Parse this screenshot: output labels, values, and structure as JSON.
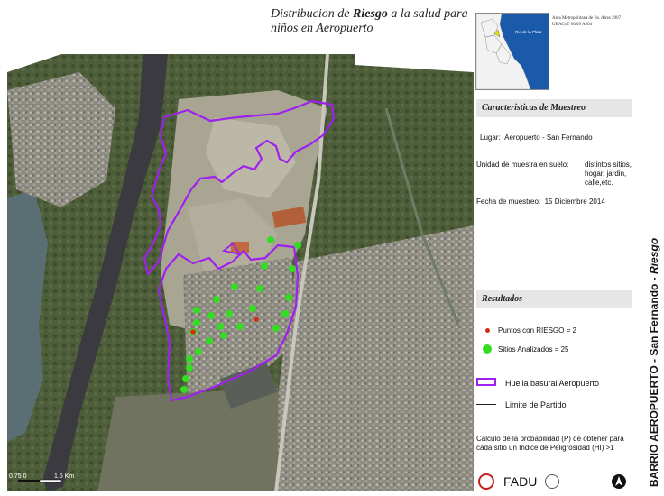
{
  "title": {
    "line1_pre": "Distribucion de ",
    "line1_bold": "Riesgo",
    "line1_post": " a la salud para",
    "line2": "niños en  Aeropuerto"
  },
  "inset": {
    "river_label": "Rio de la Plata",
    "note_line1": "Area Metropolitana de Bs. Aires 2007",
    "note_line2": "UBACyT 06/09   A804"
  },
  "muestreo": {
    "heading": "Caracteristicas de Muestreo",
    "lugar_label": "Lugar:",
    "lugar_value": "Aeropuerto - San Fernando",
    "unidad_label": "Unidad de muestra en suelo:",
    "unidad_value_1": "distintos sitios,",
    "unidad_value_2": "hogar, jardin,",
    "unidad_value_3": "calle,etc.",
    "fecha_label": "Fecha de muestreo:",
    "fecha_value": "15 Diciembre 2014"
  },
  "resultados": {
    "heading": "Resultados",
    "risk_points": "Puntos con RIESGO = 2",
    "sites": "Sitios Analizados = 25",
    "footprint": "Huella basural Aeropuerto",
    "boundary": "Limite de Partido"
  },
  "note": {
    "line1": "Calculo de la probabilidad (P) de obtener para",
    "line2": "cada sitio un Indice de Peligrosidad (HI) >1"
  },
  "scale": {
    "left": "0.75 0",
    "right": "1.5 Km"
  },
  "logos": {
    "fadu": "FADU"
  },
  "vertical_title": {
    "main": "BARRIO  AEROPUERTO - San Fernando - ",
    "italic": "Riesgo"
  },
  "colors": {
    "footprint": "#a020f0",
    "site": "#33dd22",
    "risk": "#d03010",
    "river": "#3a3a40"
  },
  "sites": {
    "green_count": 25,
    "risk_count": 2
  }
}
